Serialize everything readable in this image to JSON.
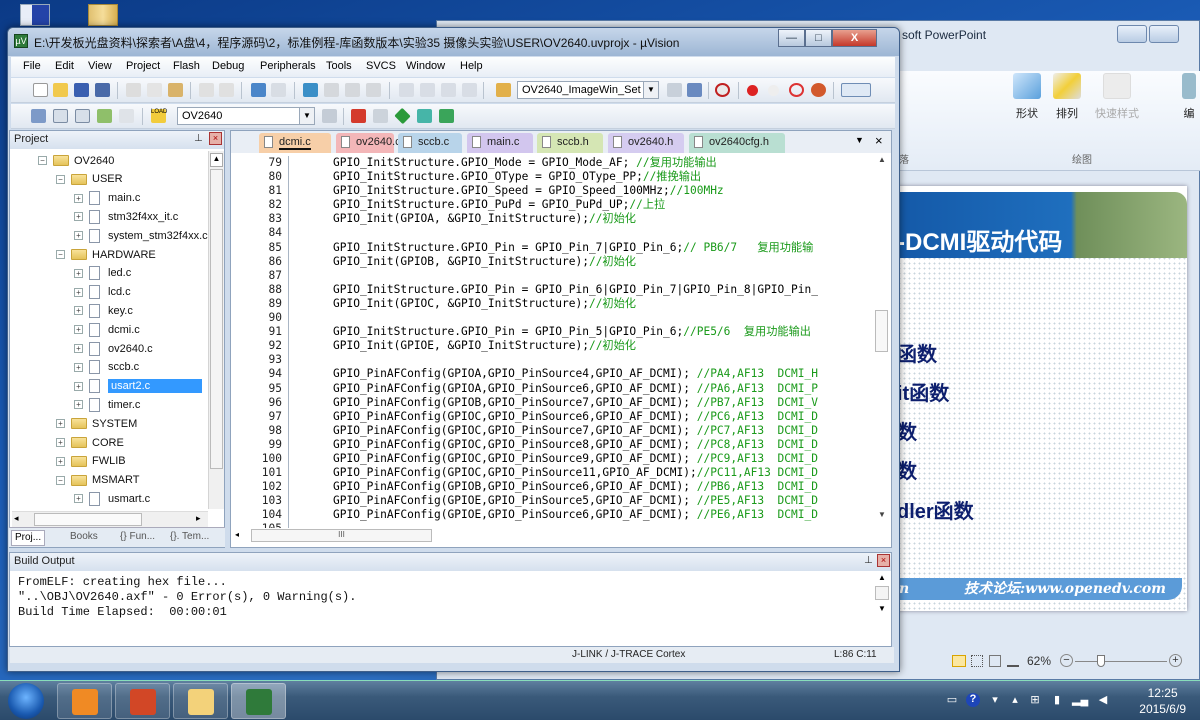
{
  "desktop": {
    "icons": [
      "computer-icon",
      "folder-icon"
    ]
  },
  "powerpoint": {
    "title": "soft PowerPoint",
    "ribbon": {
      "items": [
        {
          "label": "形状",
          "icon": "shapes-icon"
        },
        {
          "label": "排列",
          "icon": "arrange-icon"
        },
        {
          "label": "快速样式",
          "icon": "quick-styles-icon"
        },
        {
          "label": "编",
          "icon": "edit-icon"
        }
      ],
      "groups": [
        "落",
        "绘图"
      ]
    },
    "slide": {
      "title": "-DCMI驱动代码",
      "lines": [
        "函数",
        "it函数",
        "数",
        "数",
        "dler函数"
      ],
      "footer_left": "n",
      "footer": "技术论坛:www.openedv.com"
    },
    "status": {
      "zoom": "62%"
    }
  },
  "keil": {
    "title": "E:\\开发板光盘资料\\探索者\\A盘\\4，程序源码\\2，标准例程-库函数版本\\实验35 摄像头实验\\USER\\OV2640.uvprojx - µVision",
    "app_icon": "µV",
    "window_controls": {
      "minimize": "—",
      "maximize": "□",
      "close": "X"
    },
    "menu": [
      "File",
      "Edit",
      "View",
      "Project",
      "Flash",
      "Debug",
      "Peripherals",
      "Tools",
      "SVCS",
      "Window",
      "Help"
    ],
    "toolbar1": {
      "find_combo": "OV2640_ImageWin_Set"
    },
    "toolbar2": {
      "target_combo": "OV2640",
      "load_label": "LOAD"
    },
    "project_panel": {
      "title": "Project",
      "tree": [
        {
          "label": "OV2640",
          "type": "root",
          "level": 0,
          "expanded": true
        },
        {
          "label": "USER",
          "type": "folder",
          "level": 1,
          "expanded": true
        },
        {
          "label": "main.c",
          "type": "file",
          "level": 2
        },
        {
          "label": "stm32f4xx_it.c",
          "type": "file",
          "level": 2
        },
        {
          "label": "system_stm32f4xx.c",
          "type": "file",
          "level": 2
        },
        {
          "label": "HARDWARE",
          "type": "folder",
          "level": 1,
          "expanded": true
        },
        {
          "label": "led.c",
          "type": "file",
          "level": 2
        },
        {
          "label": "lcd.c",
          "type": "file",
          "level": 2
        },
        {
          "label": "key.c",
          "type": "file",
          "level": 2
        },
        {
          "label": "dcmi.c",
          "type": "file",
          "level": 2
        },
        {
          "label": "ov2640.c",
          "type": "file",
          "level": 2
        },
        {
          "label": "sccb.c",
          "type": "file",
          "level": 2
        },
        {
          "label": "usart2.c",
          "type": "file",
          "level": 2,
          "selected": true
        },
        {
          "label": "timer.c",
          "type": "file",
          "level": 2
        },
        {
          "label": "SYSTEM",
          "type": "folder",
          "level": 1,
          "expanded": false
        },
        {
          "label": "CORE",
          "type": "folder",
          "level": 1,
          "expanded": false
        },
        {
          "label": "FWLIB",
          "type": "folder",
          "level": 1,
          "expanded": false
        },
        {
          "label": "MSMART",
          "type": "folder",
          "level": 1,
          "expanded": true
        },
        {
          "label": "usmart.c",
          "type": "file",
          "level": 2
        }
      ],
      "tabs": [
        "Proj...",
        "Books",
        "{} Fun...",
        "{}. Tem..."
      ]
    },
    "editor": {
      "tabs": [
        {
          "label": "dcmi.c",
          "color": "#f7cfa8",
          "active": true
        },
        {
          "label": "ov2640.c",
          "color": "#f3b6b8"
        },
        {
          "label": "sccb.c",
          "color": "#b8d4ea"
        },
        {
          "label": "main.c",
          "color": "#d2c6ee"
        },
        {
          "label": "sccb.h",
          "color": "#d5e6b4"
        },
        {
          "label": "ov2640.h",
          "color": "#d5ccf0"
        },
        {
          "label": "ov2640cfg.h",
          "color": "#b9dfd2"
        }
      ],
      "lines": [
        {
          "n": "79",
          "code": "GPIO_InitStructure.GPIO_Mode = GPIO_Mode_AF; ",
          "comment": "//复用功能输出"
        },
        {
          "n": "80",
          "code": "GPIO_InitStructure.GPIO_OType = GPIO_OType_PP;",
          "comment": "//推挽输出"
        },
        {
          "n": "81",
          "code": "GPIO_InitStructure.GPIO_Speed = GPIO_Speed_100MHz;",
          "comment": "//100MHz"
        },
        {
          "n": "82",
          "code": "GPIO_InitStructure.GPIO_PuPd = GPIO_PuPd_UP;",
          "comment": "//上拉"
        },
        {
          "n": "83",
          "code": "GPIO_Init(GPIOA, &GPIO_InitStructure);",
          "comment": "//初始化"
        },
        {
          "n": "84",
          "code": "",
          "comment": ""
        },
        {
          "n": "85",
          "code": "GPIO_InitStructure.GPIO_Pin = GPIO_Pin_7|GPIO_Pin_6;",
          "comment": "// PB6/7   复用功能输"
        },
        {
          "n": "86",
          "code": "GPIO_Init(GPIOB, &GPIO_InitStructure);",
          "comment": "//初始化"
        },
        {
          "n": "87",
          "code": "",
          "comment": ""
        },
        {
          "n": "88",
          "code": "GPIO_InitStructure.GPIO_Pin = GPIO_Pin_6|GPIO_Pin_7|GPIO_Pin_8|GPIO_Pin_",
          "comment": ""
        },
        {
          "n": "89",
          "code": "GPIO_Init(GPIOC, &GPIO_InitStructure);",
          "comment": "//初始化"
        },
        {
          "n": "90",
          "code": "",
          "comment": ""
        },
        {
          "n": "91",
          "code": "GPIO_InitStructure.GPIO_Pin = GPIO_Pin_5|GPIO_Pin_6;",
          "comment": "//PE5/6  复用功能输出"
        },
        {
          "n": "92",
          "code": "GPIO_Init(GPIOE, &GPIO_InitStructure);",
          "comment": "//初始化"
        },
        {
          "n": "93",
          "code": "",
          "comment": ""
        },
        {
          "n": "94",
          "code": "GPIO_PinAFConfig(GPIOA,GPIO_PinSource4,GPIO_AF_DCMI); ",
          "comment": "//PA4,AF13  DCMI_H"
        },
        {
          "n": "95",
          "code": "GPIO_PinAFConfig(GPIOA,GPIO_PinSource6,GPIO_AF_DCMI); ",
          "comment": "//PA6,AF13  DCMI_P"
        },
        {
          "n": "96",
          "code": "GPIO_PinAFConfig(GPIOB,GPIO_PinSource7,GPIO_AF_DCMI); ",
          "comment": "//PB7,AF13  DCMI_V"
        },
        {
          "n": "97",
          "code": "GPIO_PinAFConfig(GPIOC,GPIO_PinSource6,GPIO_AF_DCMI); ",
          "comment": "//PC6,AF13  DCMI_D"
        },
        {
          "n": "98",
          "code": "GPIO_PinAFConfig(GPIOC,GPIO_PinSource7,GPIO_AF_DCMI); ",
          "comment": "//PC7,AF13  DCMI_D"
        },
        {
          "n": "99",
          "code": "GPIO_PinAFConfig(GPIOC,GPIO_PinSource8,GPIO_AF_DCMI); ",
          "comment": "//PC8,AF13  DCMI_D"
        },
        {
          "n": "100",
          "code": "GPIO_PinAFConfig(GPIOC,GPIO_PinSource9,GPIO_AF_DCMI); ",
          "comment": "//PC9,AF13  DCMI_D"
        },
        {
          "n": "101",
          "code": "GPIO_PinAFConfig(GPIOC,GPIO_PinSource11,GPIO_AF_DCMI);",
          "comment": "//PC11,AF13 DCMI_D"
        },
        {
          "n": "102",
          "code": "GPIO_PinAFConfig(GPIOB,GPIO_PinSource6,GPIO_AF_DCMI); ",
          "comment": "//PB6,AF13  DCMI_D"
        },
        {
          "n": "103",
          "code": "GPIO_PinAFConfig(GPIOE,GPIO_PinSource5,GPIO_AF_DCMI); ",
          "comment": "//PE5,AF13  DCMI_D"
        },
        {
          "n": "104",
          "code": "GPIO_PinAFConfig(GPIOE,GPIO_PinSource6,GPIO_AF_DCMI); ",
          "comment": "//PE6,AF13  DCMI_D"
        },
        {
          "n": "105",
          "code": "",
          "comment": ""
        }
      ],
      "hscroll_grip": "III"
    },
    "build_output": {
      "title": "Build Output",
      "lines": [
        "FromELF: creating hex file...",
        "\"..\\OBJ\\OV2640.axf\" - 0 Error(s), 0 Warning(s).",
        "Build Time Elapsed:  00:00:01"
      ]
    },
    "statusbar": {
      "debugger": "J-LINK / J-TRACE Cortex",
      "position": "L:86 C:11"
    }
  },
  "taskbar": {
    "apps": [
      {
        "name": "foxit-pdf",
        "color": "#f08a24"
      },
      {
        "name": "powerpoint",
        "color": "#d24726"
      },
      {
        "name": "explorer",
        "color": "#f3d27a"
      },
      {
        "name": "keil-uvision",
        "color": "#2f7a3a"
      }
    ],
    "time": "12:25",
    "date": "2015/6/9"
  }
}
